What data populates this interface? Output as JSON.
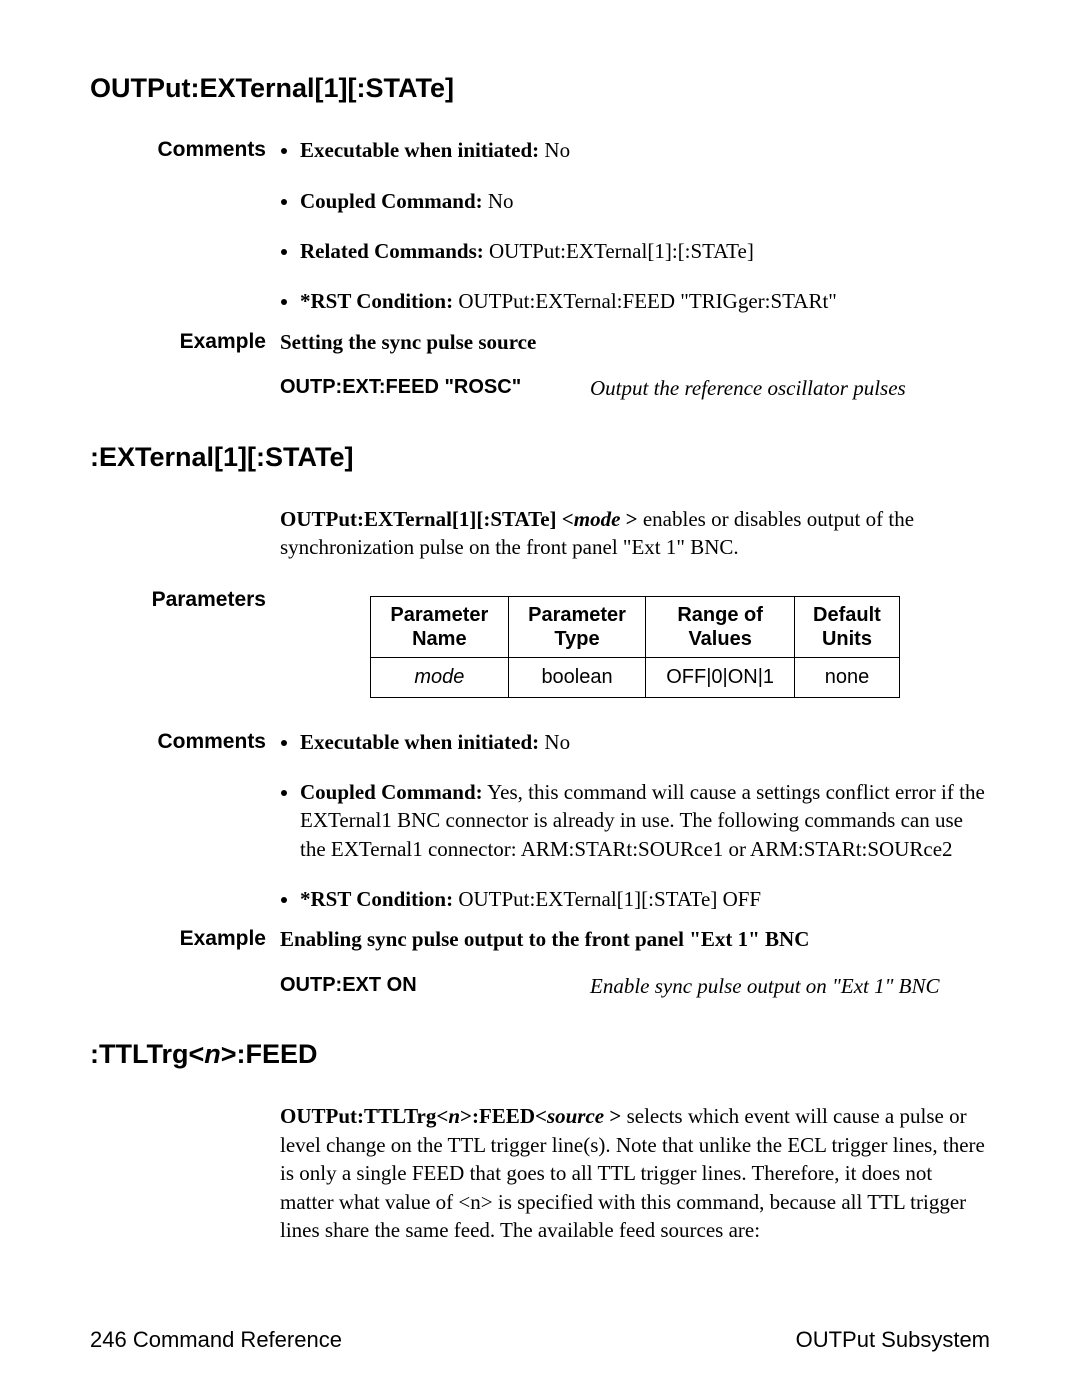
{
  "heading1": "OUTPut:EXTernal[1][:STATe]",
  "section1": {
    "comments_label": "Comments",
    "bullets": [
      {
        "label": "Executable when initiated:",
        "value": " No"
      },
      {
        "label": "Coupled Command:",
        "value": " No"
      },
      {
        "label": "Related Commands:",
        "value": " OUTPut:EXTernal[1]:[:STATe]"
      },
      {
        "label": "*RST Condition:",
        "value": " OUTPut:EXTernal:FEED \"TRIGger:STARt\""
      }
    ],
    "example_label": "Example",
    "example_title": "Setting the sync pulse source",
    "example_cmd": "OUTP:EXT:FEED \"ROSC\"",
    "example_note": "Output  the reference oscillator pulses"
  },
  "heading2": ":EXTernal[1][:STATe]",
  "section2": {
    "intro_cmd": "OUTPut:EXTernal[1][:STATe] <",
    "intro_param": "mode ",
    "intro_close": ">",
    "intro_rest": " enables or disables output of the synchronization pulse on the front panel \"Ext 1\" BNC.",
    "parameters_label": "Parameters",
    "table": {
      "headers": {
        "c1a": "Parameter",
        "c1b": "Name",
        "c2a": "Parameter",
        "c2b": "Type",
        "c3a": "Range of",
        "c3b": "Values",
        "c4a": "Default",
        "c4b": "Units"
      },
      "row": {
        "name": "mode",
        "type": "boolean",
        "range": "OFF|0|ON|1",
        "units": "none"
      }
    },
    "comments_label": "Comments",
    "bullets": [
      {
        "label": "Executable when initiated:",
        "value": " No"
      },
      {
        "label": "Coupled Command:",
        "value": " Yes, this command will cause a settings conflict error if the EXTernal1 BNC connector is already in use. The following commands can use the EXTernal1 connector: ARM:STARt:SOURce1 or ARM:STARt:SOURce2"
      },
      {
        "label": "*RST Condition:",
        "value": " OUTPut:EXTernal[1][:STATe] OFF"
      }
    ],
    "example_label": "Example",
    "example_title": "Enabling sync pulse output to the front panel \"Ext 1\" BNC",
    "example_cmd": "OUTP:EXT ON",
    "example_note": "Enable sync pulse output on \"Ext 1\" BNC"
  },
  "heading3_a": ":TTLTrg<",
  "heading3_b": "n",
  "heading3_c": ">:FEED",
  "section3": {
    "para_a": "OUTPut:TTLTrg<",
    "para_b": "n",
    "para_c": ">:FEED<",
    "para_d": "source ",
    "para_e": ">",
    "para_rest": " selects which event will cause a pulse or level change on the TTL trigger line(s).  Note that unlike the ECL trigger lines, there is only a single FEED that goes to all TTL trigger lines.  Therefore, it does not matter what value of <n> is specified with this command, because all TTL trigger lines share the same feed.  The available feed sources are:"
  },
  "footer": {
    "left_num": "246",
    "left_text": "  Command Reference",
    "right_text": "OUTPut  Subsystem"
  }
}
